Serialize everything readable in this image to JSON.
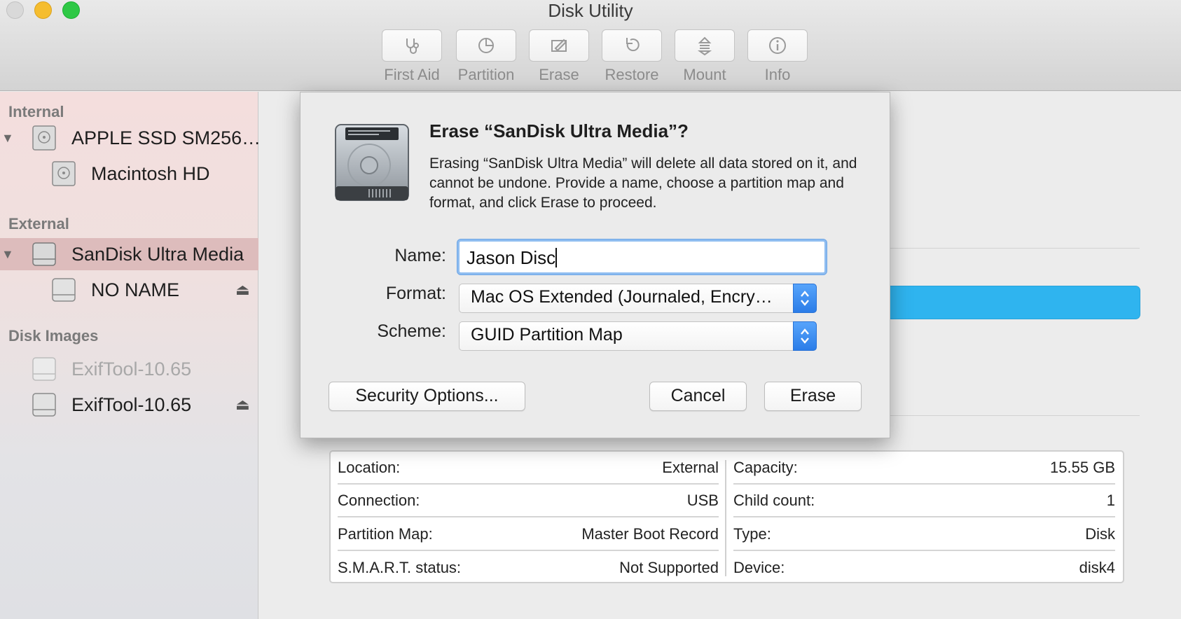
{
  "window": {
    "title": "Disk Utility"
  },
  "toolbar": {
    "items": [
      {
        "label": "First Aid",
        "icon": "stethoscope-icon"
      },
      {
        "label": "Partition",
        "icon": "pie-chart-icon"
      },
      {
        "label": "Erase",
        "icon": "pencil-eraser-icon"
      },
      {
        "label": "Restore",
        "icon": "restore-arrow-icon"
      },
      {
        "label": "Mount",
        "icon": "mount-icon"
      },
      {
        "label": "Info",
        "icon": "info-icon"
      }
    ]
  },
  "sidebar": {
    "sections": [
      {
        "title": "Internal"
      },
      {
        "title": "External"
      },
      {
        "title": "Disk Images"
      }
    ],
    "items": [
      {
        "label": "APPLE SSD SM256…",
        "icon": "internal-disk-icon"
      },
      {
        "label": "Macintosh HD",
        "icon": "internal-volume-icon"
      },
      {
        "label": "SanDisk Ultra Media",
        "icon": "external-disk-icon",
        "selected": true
      },
      {
        "label": "NO NAME",
        "icon": "external-volume-icon",
        "eject": "⏏"
      },
      {
        "label": "ExifTool-10.65",
        "icon": "disk-image-icon",
        "dimmed": true
      },
      {
        "label": "ExifTool-10.65",
        "icon": "disk-image-icon",
        "eject": "⏏"
      }
    ]
  },
  "dialog": {
    "title": "Erase “SanDisk Ultra Media”?",
    "message": "Erasing “SanDisk Ultra Media” will delete all data stored on it, and cannot be undone. Provide a name, choose a partition map and format, and click Erase to proceed.",
    "name_label": "Name:",
    "name_value": "Jason Disc",
    "format_label": "Format:",
    "format_value": "Mac OS Extended (Journaled, Encry…",
    "scheme_label": "Scheme:",
    "scheme_value": "GUID Partition Map",
    "security_button": "Security Options...",
    "cancel_button": "Cancel",
    "erase_button": "Erase"
  },
  "info": {
    "left": [
      {
        "label": "Location:",
        "value": "External"
      },
      {
        "label": "Connection:",
        "value": "USB"
      },
      {
        "label": "Partition Map:",
        "value": "Master Boot Record"
      },
      {
        "label": "S.M.A.R.T. status:",
        "value": "Not Supported"
      }
    ],
    "right": [
      {
        "label": "Capacity:",
        "value": "15.55 GB"
      },
      {
        "label": "Child count:",
        "value": "1"
      },
      {
        "label": "Type:",
        "value": "Disk"
      },
      {
        "label": "Device:",
        "value": "disk4"
      }
    ]
  },
  "colors": {
    "accent": "#2fb4ef",
    "selection": "#ddbcbc",
    "stepper": "#2b7de8"
  }
}
